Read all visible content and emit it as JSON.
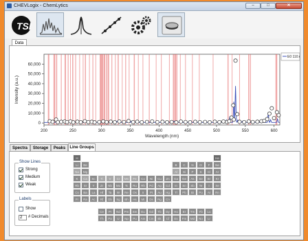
{
  "window": {
    "title": "CHEVLogix - ChemLytics",
    "controls": [
      "–",
      "□",
      "✕"
    ]
  },
  "toolbar": {
    "buttons": [
      {
        "name": "logo-button",
        "icon": "tsi-logo-icon"
      },
      {
        "name": "spectrum-button",
        "icon": "spectrum-icon"
      },
      {
        "name": "peak-button",
        "icon": "peak-icon"
      },
      {
        "name": "calibration-button",
        "icon": "calibration-line-icon"
      },
      {
        "name": "settings-button",
        "icon": "gears-icon"
      },
      {
        "name": "sample-button",
        "icon": "sample-dish-icon"
      }
    ]
  },
  "data_tab": "Data",
  "legend": {
    "label": "E0 110 A"
  },
  "chart_data": {
    "type": "line",
    "xlabel": "Wavelength (nm)",
    "ylabel": "Intensity (a.u.)",
    "xlim": [
      200,
      610
    ],
    "ylim": [
      -2000,
      70000
    ],
    "x_ticks": [
      200,
      250,
      300,
      350,
      400,
      450,
      500,
      550,
      600
    ],
    "y_ticks": [
      0,
      10000,
      20000,
      30000,
      40000,
      50000,
      60000
    ],
    "y_tick_labels": [
      "0",
      "10,000",
      "20,000",
      "30,000",
      "40,000",
      "50,000",
      "60,000"
    ],
    "series": [
      {
        "name": "E0 110 A",
        "color": "#3b4fb8",
        "peaks": [
          [
            213,
            1500
          ],
          [
            238,
            1000
          ],
          [
            257,
            1200
          ],
          [
            285,
            900
          ],
          [
            310,
            1500
          ],
          [
            327,
            1200
          ],
          [
            352,
            1300
          ],
          [
            396,
            1800
          ],
          [
            426,
            1400
          ],
          [
            456,
            1600
          ],
          [
            496,
            1300
          ],
          [
            517,
            2600
          ],
          [
            523,
            6000
          ],
          [
            530,
            21000
          ],
          [
            533,
            37000
          ],
          [
            537,
            2500
          ],
          [
            545,
            1200
          ],
          [
            577,
            2200
          ],
          [
            590,
            9500
          ],
          [
            594,
            2800
          ],
          [
            606,
            3500
          ]
        ]
      }
    ],
    "reference_lines": [
      {
        "x": 208,
        "w": 2.0
      },
      {
        "x": 218,
        "w": 2.5
      },
      {
        "x": 222,
        "w": 1.5
      },
      {
        "x": 230,
        "w": 1.2
      },
      {
        "x": 237,
        "w": 2.0
      },
      {
        "x": 242,
        "w": 1.2
      },
      {
        "x": 246,
        "w": 1.0
      },
      {
        "x": 250,
        "w": 1.5
      },
      {
        "x": 255,
        "w": 1.2
      },
      {
        "x": 262,
        "w": 1.0
      },
      {
        "x": 268,
        "w": 1.0
      },
      {
        "x": 272,
        "w": 1.5
      },
      {
        "x": 279,
        "w": 1.0
      },
      {
        "x": 285,
        "w": 1.2
      },
      {
        "x": 290,
        "w": 1.0
      },
      {
        "x": 298,
        "w": 2.0
      },
      {
        "x": 301,
        "w": 3.0
      },
      {
        "x": 305,
        "w": 2.5
      },
      {
        "x": 309,
        "w": 1.5
      },
      {
        "x": 312,
        "w": 2.0
      },
      {
        "x": 318,
        "w": 1.2
      },
      {
        "x": 324,
        "w": 1.0
      },
      {
        "x": 329,
        "w": 1.5
      },
      {
        "x": 336,
        "w": 1.0
      },
      {
        "x": 342,
        "w": 1.2
      },
      {
        "x": 348,
        "w": 1.0
      },
      {
        "x": 357,
        "w": 1.5
      },
      {
        "x": 364,
        "w": 1.0
      },
      {
        "x": 372,
        "w": 1.0
      },
      {
        "x": 383,
        "w": 1.2
      },
      {
        "x": 395,
        "w": 1.0
      },
      {
        "x": 404,
        "w": 1.0
      },
      {
        "x": 418,
        "w": 1.0
      },
      {
        "x": 425,
        "w": 1.5
      },
      {
        "x": 428,
        "w": 2.5
      },
      {
        "x": 431,
        "w": 1.5
      },
      {
        "x": 437,
        "w": 1.0
      },
      {
        "x": 446,
        "w": 1.0
      },
      {
        "x": 458,
        "w": 1.0
      },
      {
        "x": 470,
        "w": 1.0
      },
      {
        "x": 494,
        "w": 1.0
      },
      {
        "x": 520,
        "w": 1.5
      },
      {
        "x": 527,
        "w": 1.0
      },
      {
        "x": 540,
        "w": 1.0
      },
      {
        "x": 556,
        "w": 1.5
      },
      {
        "x": 559,
        "w": 1.2
      },
      {
        "x": 604,
        "w": 2.5
      }
    ],
    "markers": [
      [
        210,
        1800
      ],
      [
        215,
        1200
      ],
      [
        221,
        3500
      ],
      [
        224,
        800
      ],
      [
        230,
        1200
      ],
      [
        236,
        1500
      ],
      [
        240,
        900
      ],
      [
        246,
        1600
      ],
      [
        251,
        700
      ],
      [
        258,
        1300
      ],
      [
        264,
        800
      ],
      [
        271,
        1800
      ],
      [
        277,
        900
      ],
      [
        283,
        1200
      ],
      [
        288,
        700
      ],
      [
        296,
        1000
      ],
      [
        303,
        1600
      ],
      [
        309,
        900
      ],
      [
        316,
        1300
      ],
      [
        323,
        800
      ],
      [
        331,
        1500
      ],
      [
        339,
        1000
      ],
      [
        347,
        2000
      ],
      [
        355,
        900
      ],
      [
        362,
        1300
      ],
      [
        370,
        800
      ],
      [
        379,
        1100
      ],
      [
        388,
        1600
      ],
      [
        397,
        900
      ],
      [
        406,
        1200
      ],
      [
        414,
        800
      ],
      [
        422,
        1000
      ],
      [
        430,
        700
      ],
      [
        438,
        1400
      ],
      [
        446,
        1000
      ],
      [
        454,
        800
      ],
      [
        463,
        1200
      ],
      [
        471,
        900
      ],
      [
        480,
        1100
      ],
      [
        488,
        800
      ],
      [
        497,
        1300
      ],
      [
        505,
        900
      ],
      [
        512,
        1500
      ],
      [
        518,
        1000
      ],
      [
        522,
        1800
      ],
      [
        526,
        5500
      ],
      [
        529,
        18000
      ],
      [
        530,
        3500
      ],
      [
        533,
        63500
      ],
      [
        536,
        9000
      ],
      [
        540,
        1200
      ],
      [
        548,
        900
      ],
      [
        556,
        1600
      ],
      [
        563,
        1000
      ],
      [
        571,
        1300
      ],
      [
        578,
        1800
      ],
      [
        583,
        2200
      ],
      [
        588,
        4000
      ],
      [
        592,
        9500
      ],
      [
        596,
        15000
      ],
      [
        600,
        5000
      ],
      [
        605,
        11000
      ],
      [
        608,
        8000
      ]
    ]
  },
  "bottom_tabs": [
    "Spectra",
    "Storage",
    "Peaks",
    "Line Groups"
  ],
  "show_lines": {
    "title": "Show Lines",
    "items": [
      {
        "label": "Strong",
        "checked": true
      },
      {
        "label": "Medium",
        "checked": true
      },
      {
        "label": "Weak",
        "checked": true
      }
    ]
  },
  "labels_group": {
    "title": "Labels",
    "show_label": "Show",
    "show_checked": false,
    "decimals_value": "2",
    "decimals_label": "# Decimals"
  },
  "periodic_table": {
    "main": [
      [
        "H",
        "",
        "",
        "",
        "",
        "",
        "",
        "",
        "",
        "",
        "",
        "",
        "",
        "",
        "",
        "",
        "",
        "He"
      ],
      [
        "Li",
        "Be",
        "",
        "",
        "",
        "",
        "",
        "",
        "",
        "",
        "",
        "",
        "B",
        "C",
        "N",
        "O",
        "F",
        "Ne"
      ],
      [
        "Na",
        "Mg",
        "",
        "",
        "",
        "",
        "",
        "",
        "",
        "",
        "",
        "",
        "Al",
        "Si",
        "P",
        "S",
        "Cl",
        "Ar"
      ],
      [
        "K",
        "Ca",
        "Sc",
        "Ti",
        "V",
        "Cr",
        "Mn",
        "Fe",
        "Co",
        "Ni",
        "Cu",
        "Zn",
        "Ga",
        "Ge",
        "As",
        "Se",
        "Br",
        "Kr"
      ],
      [
        "Rb",
        "Sr",
        "Y",
        "Zr",
        "Nb",
        "Mo",
        "Tc",
        "Ru",
        "Rh",
        "Pd",
        "Ag",
        "Cd",
        "In",
        "Sn",
        "Sb",
        "Te",
        "I",
        "Xe"
      ],
      [
        "Cs",
        "Ba",
        "La",
        "Hf",
        "Ta",
        "W",
        "Re",
        "Os",
        "Ir",
        "Pt",
        "Au",
        "Hg",
        "Tl",
        "Pb",
        "Bi",
        "Po",
        "At",
        "Rn"
      ],
      [
        "Fr",
        "Ra",
        "Ac",
        "Rf",
        "Db",
        "Sg",
        "Bh",
        "Hs",
        "Mt",
        "Ds",
        "Rg",
        "Cn",
        "",
        "",
        "",
        "",
        "",
        ""
      ]
    ],
    "lanthanides": [
      "Ce",
      "Pr",
      "Nd",
      "Pm",
      "Sm",
      "Eu",
      "Gd",
      "Tb",
      "Dy",
      "Ho",
      "Er",
      "Tm",
      "Yb",
      "Lu"
    ],
    "actinides": [
      "Th",
      "Pa",
      "U",
      "Np",
      "Pu",
      "Am",
      "Cm",
      "Bk",
      "Cf",
      "Es",
      "Fm",
      "Md",
      "No",
      "Lr"
    ],
    "highlighted": [
      "Na",
      "Al",
      "Ti",
      "V",
      "Cr",
      "Mn",
      "Fe",
      "Ca"
    ]
  }
}
